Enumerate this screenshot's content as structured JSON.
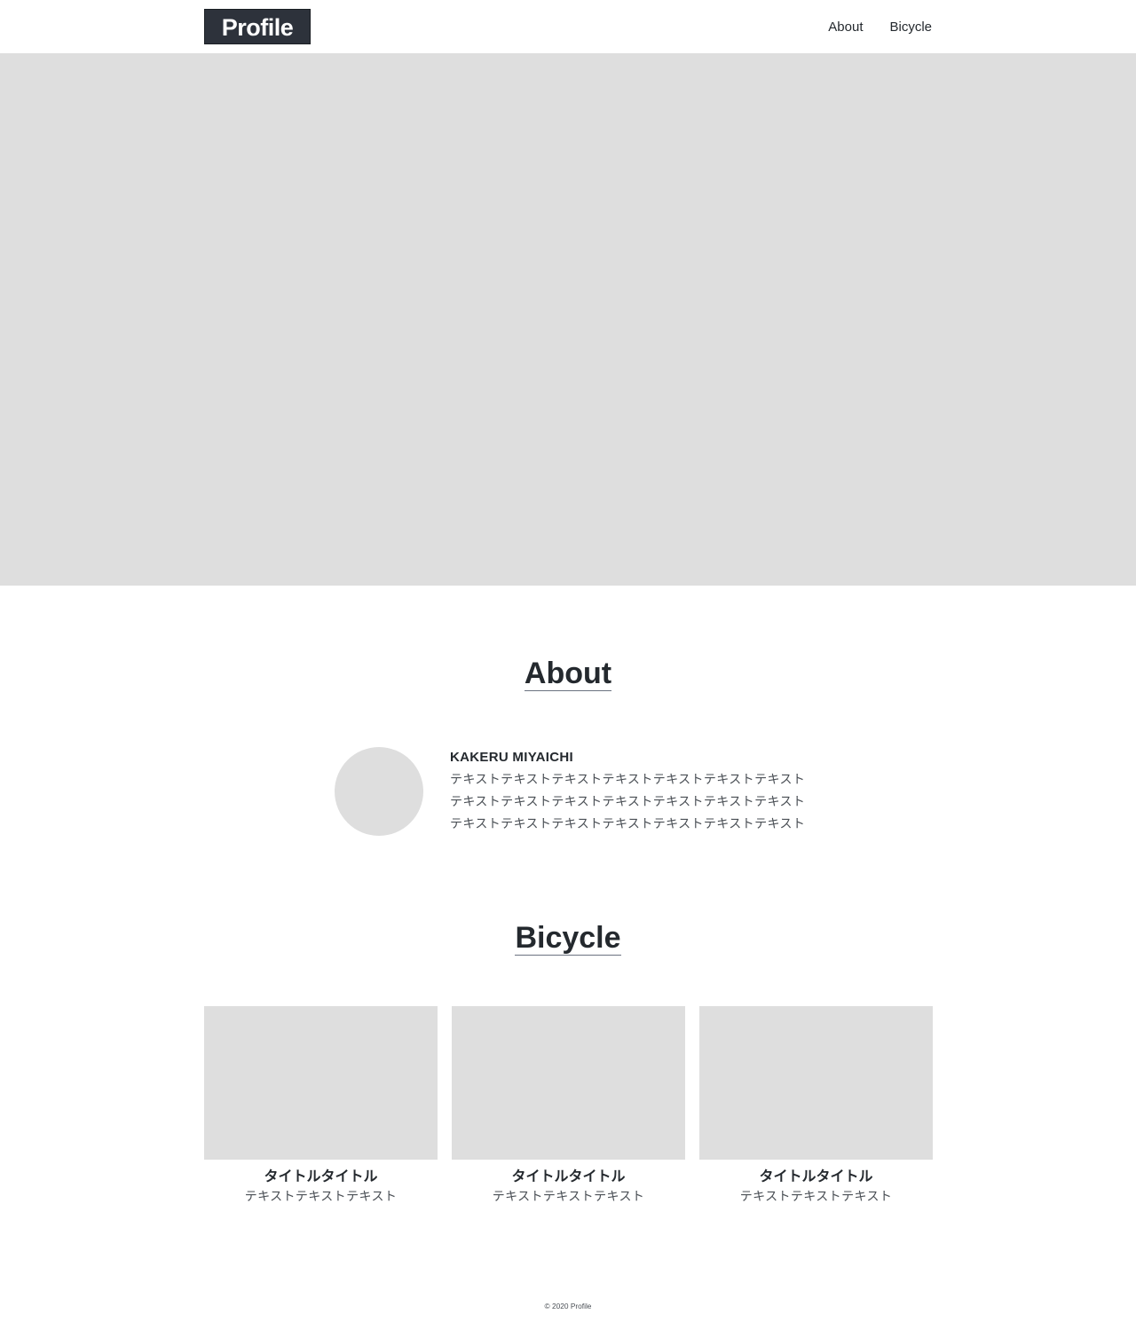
{
  "header": {
    "logo": "Profile",
    "nav": [
      "About",
      "Bicycle"
    ]
  },
  "about": {
    "title": "About",
    "name": "KAKERU MIYAICHI",
    "lines": [
      "テキストテキストテキストテキストテキストテキストテキスト",
      "テキストテキストテキストテキストテキストテキストテキスト",
      "テキストテキストテキストテキストテキストテキストテキスト"
    ]
  },
  "bicycle": {
    "title": "Bicycle",
    "cards": [
      {
        "title": "タイトルタイトル",
        "text": "テキストテキストテキスト"
      },
      {
        "title": "タイトルタイトル",
        "text": "テキストテキストテキスト"
      },
      {
        "title": "タイトルタイトル",
        "text": "テキストテキストテキスト"
      }
    ]
  },
  "footer": {
    "copyright": "© 2020 Profile"
  },
  "colors": {
    "logo_bg": "#2d323b",
    "placeholder": "#dedede",
    "text": "#24292e"
  }
}
